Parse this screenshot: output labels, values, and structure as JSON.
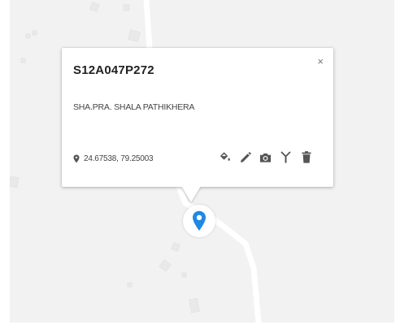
{
  "popup": {
    "title": "S12A047P272",
    "close_label": "×",
    "address": "SHA.PRA. SHALA PATHIKHERA",
    "coordinates": "24.67538, 79.25003",
    "actions": [
      {
        "name": "paint-bucket-icon"
      },
      {
        "name": "pencil-icon"
      },
      {
        "name": "camera-icon"
      },
      {
        "name": "tower-icon"
      },
      {
        "name": "trash-icon"
      }
    ]
  },
  "marker": {
    "icon": "location-pin-icon",
    "color": "#1e88e5"
  },
  "colors": {
    "map_background": "#f2f2f2",
    "road": "#ffffff",
    "icon_gray": "#555555",
    "accent": "#1e88e5"
  }
}
